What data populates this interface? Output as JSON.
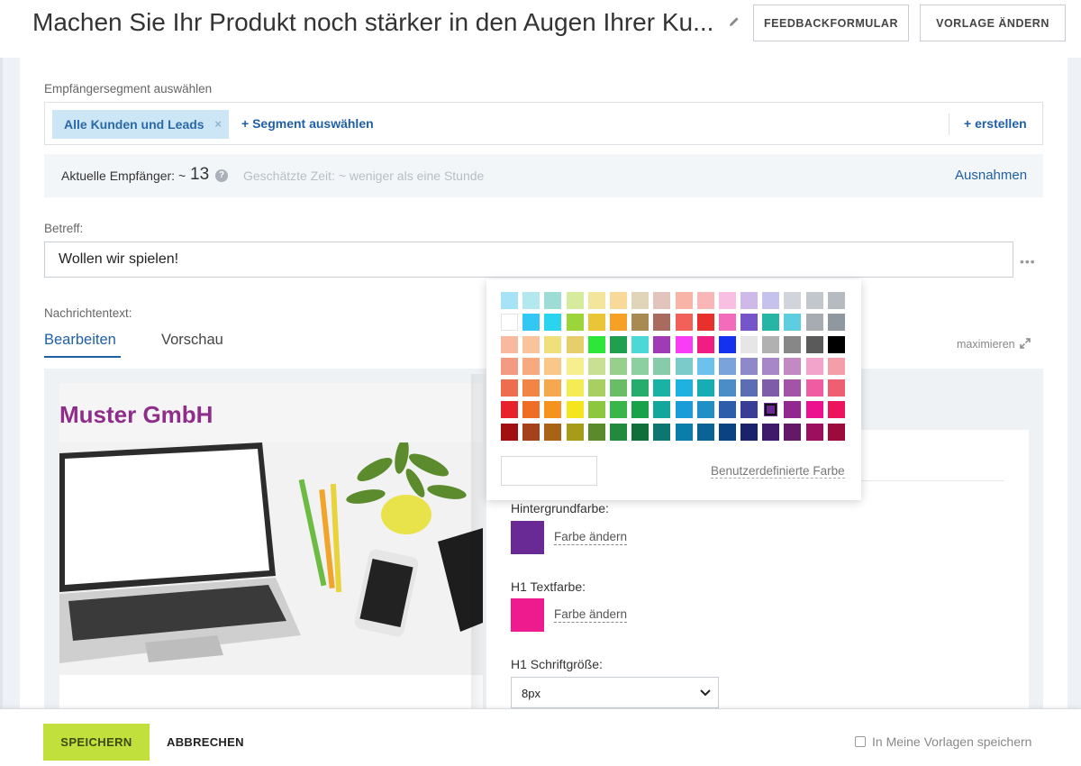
{
  "header": {
    "title": "Machen Sie Ihr Produkt noch stärker in den Augen Ihrer Ku...",
    "feedback_button": "FEEDBACKFORMULAR",
    "template_button": "VORLAGE ÄNDERN"
  },
  "segment": {
    "label": "Empfängersegment auswählen",
    "selected_tag": "Alle Kunden und Leads",
    "remove_symbol": "×",
    "select_link": "+ Segment auswählen",
    "create_link": "+ erstellen"
  },
  "recipients": {
    "label": "Aktuelle Empfänger: ~",
    "count": "13",
    "help_symbol": "?",
    "estimated_time": "Geschätzte Zeit: ~ weniger als eine Stunde",
    "exceptions_link": "Ausnahmen"
  },
  "subject": {
    "label": "Betreff:",
    "value": "Wollen wir spielen!",
    "more_symbol": "•••"
  },
  "message": {
    "label": "Nachrichtentext:",
    "tabs": [
      {
        "label": "Bearbeiten",
        "active": true
      },
      {
        "label": "Vorschau",
        "active": false
      }
    ],
    "maximize": "maximieren"
  },
  "email_preview": {
    "brand": "Muster GmbH",
    "brand_color": "#8e2e8a"
  },
  "settings_panel": {
    "background_label": "Hintergrundfarbe:",
    "background_color": "#6a2a96",
    "change_color_link": "Farbe ändern",
    "h1_color_label": "H1 Textfarbe:",
    "h1_color": "#ee1b8f",
    "h1_size_label": "H1 Schriftgröße:",
    "h1_size_value": "8px"
  },
  "color_picker": {
    "selected": "#6a2a96",
    "custom_link": "Benutzerdefinierte Farbe",
    "rows": [
      [
        "#a7e3f6",
        "#b3e8ef",
        "#9edcd6",
        "#d6ec9c",
        "#f3e59b",
        "#f9d99a",
        "#e0d4b9",
        "#e3c4bc",
        "#f8b4a6",
        "#f9b6b6",
        "#f9bfe2",
        "#cfb9e8",
        "#c6c2ee",
        "#d1d5db",
        "#c2c7cd",
        "#b5bbc1"
      ],
      [
        "#ffffff",
        "#33c8f4",
        "#2ad3ee",
        "#9bd53a",
        "#ebc538",
        "#f6a125",
        "#a88a52",
        "#a96b5d",
        "#f2605a",
        "#e8302c",
        "#f36cbc",
        "#7655cb",
        "#27b5a5",
        "#5fcde0",
        "#a7abb2",
        "#8f97a0"
      ],
      [
        "#f9b9a0",
        "#f9c49c",
        "#f0e07c",
        "#e6cf6b",
        "#2ee63a",
        "#1ea04e",
        "#4dd8d8",
        "#a13bb5",
        "#f93cf5",
        "#f01d82",
        "#1431ef",
        "#e6e6e6",
        "#b1b1b1",
        "#878787",
        "#5a5a5a",
        "#000000"
      ],
      [
        "#f39a82",
        "#f6aa7d",
        "#f9c888",
        "#f7ef8e",
        "#c8df94",
        "#96d08c",
        "#8ccfa0",
        "#86ccaa",
        "#7ccbcb",
        "#6bc2ed",
        "#7aa3dc",
        "#8f88c9",
        "#a887c8",
        "#c289c3",
        "#f3a4cb",
        "#f39ea8"
      ],
      [
        "#ef6d4f",
        "#f28546",
        "#f6a84e",
        "#f5eb54",
        "#a7cf62",
        "#6abd67",
        "#26ac6d",
        "#1ab2a4",
        "#1fb2e0",
        "#16adb3",
        "#4b8ec7",
        "#5b6eb4",
        "#7e5caa",
        "#a454a6",
        "#ef5ca1",
        "#ef5f72"
      ],
      [
        "#e8222b",
        "#ef6d25",
        "#f6931f",
        "#f4e51f",
        "#8dc63f",
        "#39b54a",
        "#1aa24a",
        "#12a79d",
        "#1a9cd9",
        "#1f8fc6",
        "#2c5ea9",
        "#383d96",
        "#6a2a96",
        "#92278f",
        "#ec118f",
        "#ec145d"
      ],
      [
        "#a10f13",
        "#a4431b",
        "#a86316",
        "#a79c17",
        "#5b8a2c",
        "#218a3c",
        "#0f6e39",
        "#0d7670",
        "#0b7dab",
        "#0a6295",
        "#0b4382",
        "#1a226c",
        "#401a6a",
        "#651768",
        "#9c0f5e",
        "#9d0a3c"
      ]
    ]
  },
  "footer": {
    "save_button": "SPEICHERN",
    "cancel_button": "ABBRECHEN",
    "save_template_label": "In Meine Vorlagen speichern"
  }
}
